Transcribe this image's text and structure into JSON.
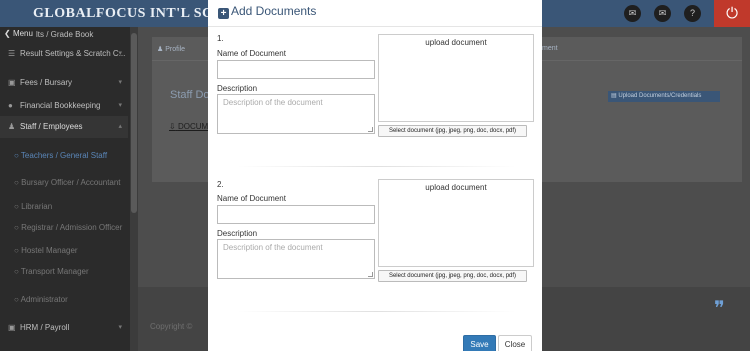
{
  "app": {
    "title": "GLOBALFOCUS INT'L SCHOOL",
    "menu_label": "Menu",
    "power_icon": "power-icon"
  },
  "sidebar": {
    "items": [
      {
        "label": "lts / Grade Book",
        "icon": "book-icon"
      },
      {
        "label": "Result Settings & Scratch C...",
        "icon": "list-icon"
      },
      {
        "label": "Fees / Bursary",
        "icon": "money-icon"
      },
      {
        "label": "Financial Bookkeeping",
        "icon": "pie-icon"
      },
      {
        "label": "Staff / Employees",
        "icon": "user-icon"
      },
      {
        "label": "HRM / Payroll",
        "icon": "money-icon"
      }
    ],
    "subitems": [
      "Teachers / General Staff",
      "Bursary Officer / Accountant",
      "Librarian",
      "Registrar / Admission Officer",
      "Hostel Manager",
      "Transport Manager",
      "Administrator"
    ]
  },
  "background": {
    "tabs": [
      "Profile",
      "ment"
    ],
    "heading": "Staff Doc",
    "upload_button": "Upload Documents/Credentials",
    "doc_link": "DOCUM",
    "footer": "Copyright ©"
  },
  "modal": {
    "title": "Add Documents",
    "documents": [
      {
        "number": "1.",
        "name_label": "Name of Document",
        "name_value": "",
        "desc_label": "Description",
        "desc_placeholder": "Description of the document",
        "upload_title": "upload document",
        "select_label": "Select document (jpg, jpeg, png, doc, docx, pdf)"
      },
      {
        "number": "2.",
        "name_label": "Name of Document",
        "name_value": "",
        "desc_label": "Description",
        "desc_placeholder": "Description of the document",
        "upload_title": "upload document",
        "select_label": "Select document (jpg, jpeg, png, doc, docx, pdf)"
      }
    ],
    "save_label": "Save",
    "close_label": "Close"
  },
  "colors": {
    "brand": "#3a5677",
    "primary_button": "#337ab7",
    "power": "#c0392b"
  }
}
